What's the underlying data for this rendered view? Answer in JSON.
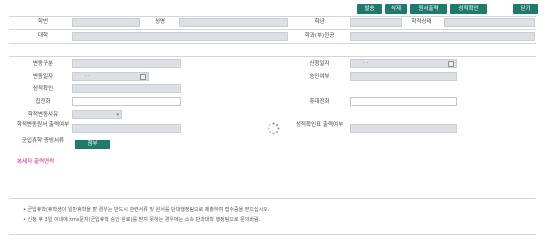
{
  "toolbar": {
    "buttons": [
      "발송",
      "삭제",
      "원서출력",
      "성적확인",
      "닫기"
    ]
  },
  "student": {
    "id_label": "학번",
    "name_label": "성명",
    "grade_label": "학년",
    "enroll_label": "학적상태",
    "college_label": "대학",
    "major_label": "학과(부)전공"
  },
  "form": {
    "change_type_label": "변동구분",
    "apply_date_label": "신청일자",
    "change_date_label": "변동일자",
    "approval_label": "승인여부",
    "grade_confirm_label": "성적확인",
    "phone_label": "집전화",
    "mobile_label": "휴대전화",
    "reason_label": "학적변동사유",
    "doc_print_label": "학적변동원서 출력여부",
    "grade_print_label": "성적확인표 출력여부",
    "military_label": "군입휴학 증빙서류",
    "attach_button": "첨부",
    "date_placeholder": "- -"
  },
  "warning": "복세자 출력연락",
  "notes": [
    "• 군입휴학(휴학생이 일반휴학을 할 경우는 반드시 관련서류 및 원서를 단대행정팀으로 제출하여 접수증을 받으십시오.",
    "• 신청 후 3일 이내에 sms문자(군입휴학 승인 완료)를 받지 못하는 경우에는 소속 단과대학 행정팀으로 문의바람."
  ],
  "colors": {
    "accent": "#1f7a6c",
    "field": "#dcdfe3",
    "warning": "#cc1f8a"
  }
}
